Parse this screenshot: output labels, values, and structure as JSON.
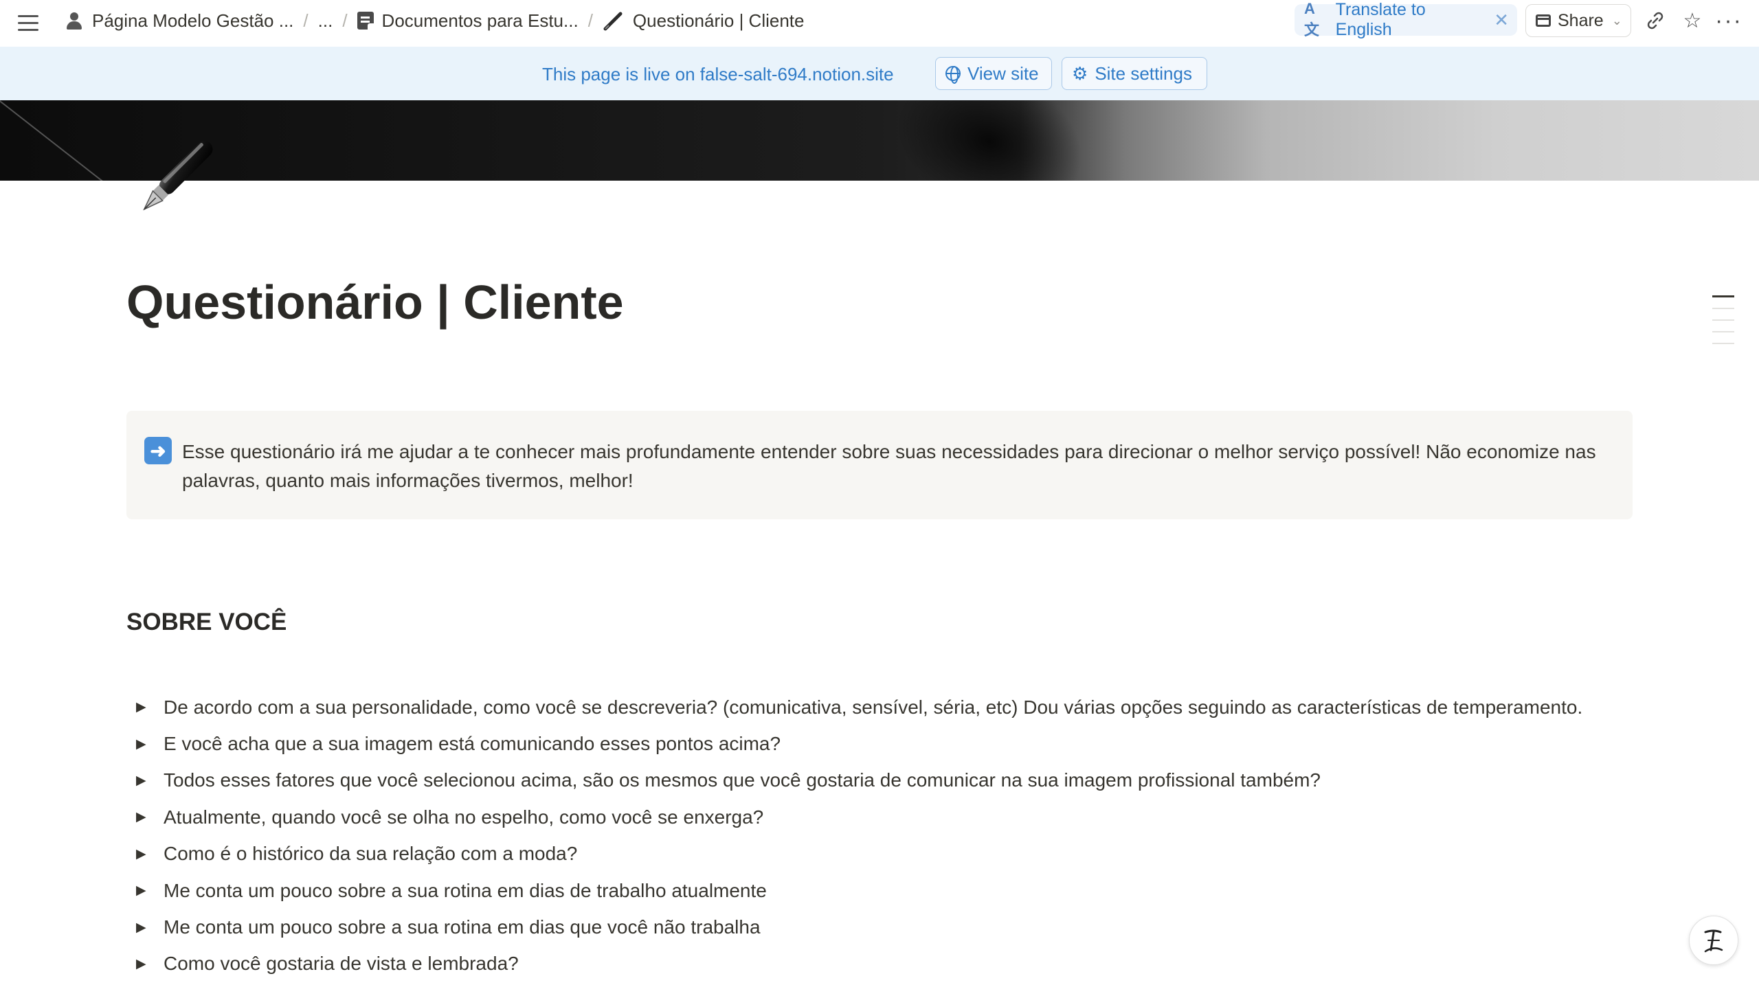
{
  "topbar": {
    "breadcrumbs": [
      {
        "label": "Página Modelo Gestão ...",
        "icon": "person-icon"
      },
      {
        "label": "...",
        "icon": ""
      },
      {
        "label": "Documentos para Estu...",
        "icon": "document-icon"
      },
      {
        "label": "Questionário | Cliente",
        "icon": "pen-icon"
      }
    ],
    "separator": "/",
    "translate_label": "Translate to English",
    "translate_icon": "translate-icon",
    "share_label": "Share",
    "icons": [
      "menu-icon",
      "link-icon",
      "star-icon",
      "more-icon"
    ]
  },
  "banner": {
    "text": "This page is live on false-salt-694.notion.site",
    "view_site_label": "View site",
    "site_settings_label": "Site settings"
  },
  "page": {
    "icon": "fountain-pen-icon",
    "title": "Questionário | Cliente",
    "callout": {
      "icon": "right-arrow-emoji-icon",
      "text": "Esse questionário irá me ajudar a te conhecer mais profundamente entender sobre suas necessidades para direcionar o melhor serviço possível! Não economize nas palavras, quanto mais informações tivermos, melhor!"
    },
    "section_heading": "SOBRE VOCÊ",
    "toggles": [
      "De acordo com a sua personalidade, como você se descreveria? (comunicativa, sensível, séria, etc) Dou várias opções seguindo as características de temperamento.",
      "E você acha que a sua imagem está comunicando esses pontos acima?",
      "Todos esses fatores que você selecionou acima, são os mesmos que você gostaria de comunicar na sua imagem profissional também?",
      "Atualmente, quando você se olha no espelho, como você se enxerga?",
      "Como é o histórico da sua relação com a moda?",
      "Me conta um pouco sobre a sua rotina em dias de trabalho atualmente",
      "Me conta um pouco sobre a sua rotina em dias que você não trabalha",
      "Como você gostaria de vista e lembrada?"
    ]
  },
  "colors": {
    "accent_blue": "#2f7bc7",
    "banner_bg": "#e9f3fb",
    "callout_bg": "#f7f6f3",
    "text": "#37352f"
  }
}
